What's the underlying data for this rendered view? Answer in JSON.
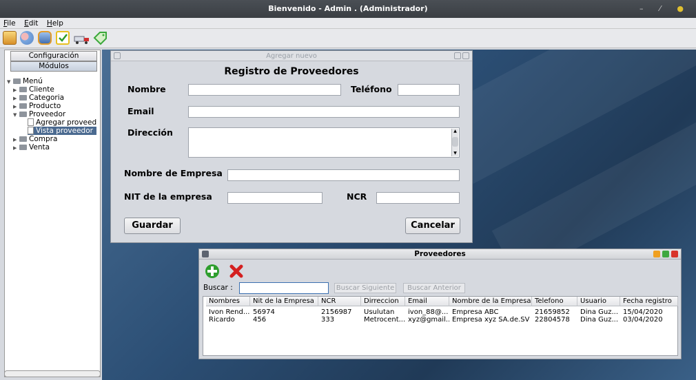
{
  "window": {
    "title": "Bienvenido - Admin . (Administrador)"
  },
  "menu": [
    "File",
    "Edit",
    "Help"
  ],
  "toolbar_icons": [
    "box-icon",
    "users-icon",
    "database-icon",
    "checklist-icon",
    "truck-icon",
    "tag-icon"
  ],
  "left_panel": {
    "tabs": [
      "Configuración",
      "Módulos"
    ],
    "tree": {
      "root": "Menú",
      "items": [
        {
          "label": "Cliente"
        },
        {
          "label": "Categoria"
        },
        {
          "label": "Producto"
        },
        {
          "label": "Proveedor",
          "children": [
            "Agregar proveed",
            "Vista proveedor"
          ]
        },
        {
          "label": "Compra"
        },
        {
          "label": "Venta"
        }
      ]
    }
  },
  "form": {
    "window_title": "Agregar nuevo",
    "heading": "Registro de Proveedores",
    "labels": {
      "nombre": "Nombre",
      "telefono": "Teléfono",
      "email": "Email",
      "direccion": "Dirección",
      "empresa": "Nombre de Empresa",
      "nit": "NIT de la empresa",
      "ncr": "NCR"
    },
    "buttons": {
      "save": "Guardar",
      "cancel": "Cancelar"
    }
  },
  "list": {
    "window_title": "Proveedores",
    "search_label": "Buscar :",
    "search_value": "",
    "next_label": "Buscar Siguiente",
    "prev_label": "Buscar Anterior",
    "columns": [
      "Nombres",
      "Nit de la Empresa",
      "NCR",
      "Dirreccion",
      "Email",
      "Nombre de la Empresa",
      "Telefono",
      "Usuario",
      "Fecha registro"
    ],
    "rows": [
      [
        "Ivon Rend...",
        "56974",
        "2156987",
        "Usulutan",
        "ivon_88@...",
        "Empresa ABC",
        "21659852",
        "Dina Guz...",
        "15/04/2020"
      ],
      [
        "Ricardo",
        "456",
        "333",
        "Metrocent...",
        "xyz@gmail...",
        "Empresa xyz SA.de.SV",
        "22804578",
        "Dina Guz...",
        "03/04/2020"
      ]
    ]
  },
  "colors": {
    "selection": "#4b6a90",
    "desktop": "#2c4f75",
    "add_icon": "#2e9e2e",
    "delete_icon": "#d42020"
  }
}
